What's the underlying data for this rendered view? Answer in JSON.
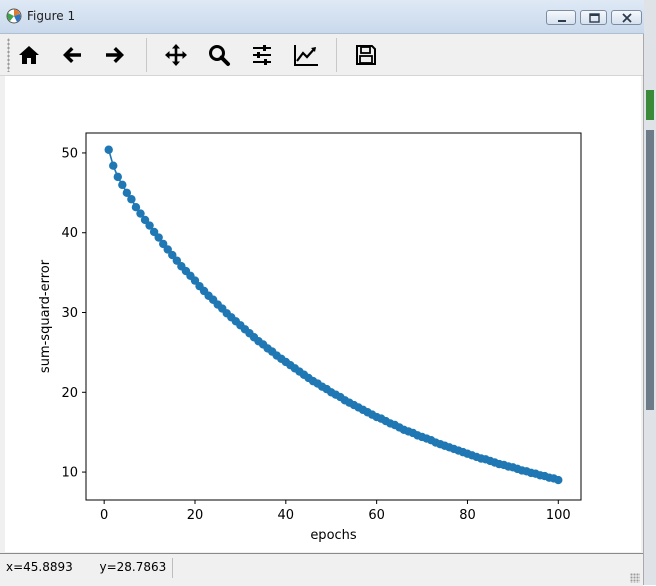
{
  "window": {
    "title": "Figure 1"
  },
  "toolbar": {
    "tools": [
      "home-icon",
      "back-arrow-icon",
      "forward-arrow-icon",
      "pan-icon",
      "zoom-icon",
      "subplots-icon",
      "edit-axis-icon",
      "save-icon"
    ]
  },
  "status": {
    "x_label": "x=45.8893",
    "y_label": "y=28.7863"
  },
  "colors": {
    "series": "#1f77b4",
    "axes": "#000000",
    "window_bg": "#f0f0f0"
  },
  "chart_data": {
    "type": "line",
    "marker": "circle",
    "title": "",
    "xlabel": "epochs",
    "ylabel": "sum-squard-error",
    "xlim": [
      -4,
      105
    ],
    "ylim": [
      6.5,
      52.5
    ],
    "xticks": [
      0,
      20,
      40,
      60,
      80,
      100
    ],
    "yticks": [
      10,
      20,
      30,
      40,
      50
    ],
    "grid": false,
    "legend": "none",
    "x": [
      1,
      2,
      3,
      4,
      5,
      6,
      7,
      8,
      9,
      10,
      11,
      12,
      13,
      14,
      15,
      16,
      17,
      18,
      19,
      20,
      21,
      22,
      23,
      24,
      25,
      26,
      27,
      28,
      29,
      30,
      31,
      32,
      33,
      34,
      35,
      36,
      37,
      38,
      39,
      40,
      41,
      42,
      43,
      44,
      45,
      46,
      47,
      48,
      49,
      50,
      51,
      52,
      53,
      54,
      55,
      56,
      57,
      58,
      59,
      60,
      61,
      62,
      63,
      64,
      65,
      66,
      67,
      68,
      69,
      70,
      71,
      72,
      73,
      74,
      75,
      76,
      77,
      78,
      79,
      80,
      81,
      82,
      83,
      84,
      85,
      86,
      87,
      88,
      89,
      90,
      91,
      92,
      93,
      94,
      95,
      96,
      97,
      98,
      99,
      100
    ],
    "y": [
      50.4,
      48.4,
      47.0,
      46.0,
      45.0,
      44.2,
      43.2,
      42.4,
      41.6,
      40.9,
      40.1,
      39.4,
      38.6,
      37.9,
      37.2,
      36.5,
      35.8,
      35.2,
      34.6,
      34.0,
      33.3,
      32.7,
      32.1,
      31.6,
      31.0,
      30.5,
      29.9,
      29.4,
      28.9,
      28.4,
      27.9,
      27.4,
      26.9,
      26.4,
      26.0,
      25.5,
      25.1,
      24.6,
      24.2,
      23.8,
      23.4,
      23.0,
      22.6,
      22.2,
      21.8,
      21.4,
      21.1,
      20.7,
      20.4,
      20.0,
      19.7,
      19.4,
      19.0,
      18.7,
      18.4,
      18.1,
      17.8,
      17.5,
      17.2,
      16.9,
      16.7,
      16.4,
      16.1,
      15.9,
      15.6,
      15.3,
      15.1,
      14.9,
      14.6,
      14.4,
      14.2,
      14.0,
      13.7,
      13.5,
      13.3,
      13.1,
      12.9,
      12.7,
      12.5,
      12.3,
      12.1,
      11.9,
      11.7,
      11.6,
      11.4,
      11.2,
      11.0,
      10.9,
      10.7,
      10.6,
      10.4,
      10.2,
      10.1,
      9.9,
      9.8,
      9.6,
      9.5,
      9.3,
      9.2,
      9.0
    ]
  }
}
